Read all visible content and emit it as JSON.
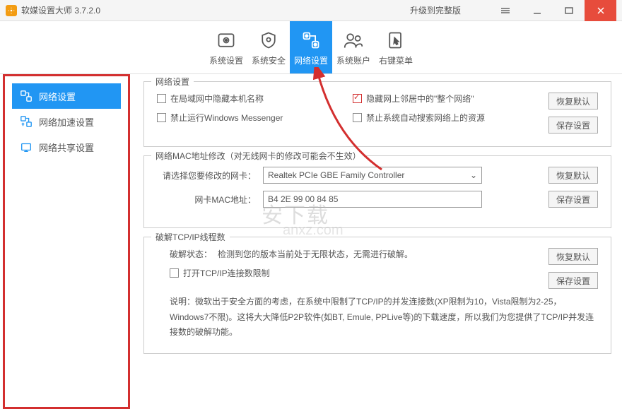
{
  "titlebar": {
    "title": "软媒设置大师 3.7.2.0",
    "upgrade": "升级到完整版"
  },
  "tabs": [
    {
      "label": "系统设置"
    },
    {
      "label": "系统安全"
    },
    {
      "label": "网络设置"
    },
    {
      "label": "系统账户"
    },
    {
      "label": "右键菜单"
    }
  ],
  "sidebar": [
    {
      "label": "网络设置"
    },
    {
      "label": "网络加速设置"
    },
    {
      "label": "网络共享设置"
    }
  ],
  "group1": {
    "title": "网络设置",
    "chk1": "在局域网中隐藏本机名称",
    "chk2": "隐藏网上邻居中的\"整个网络\"",
    "chk3": "禁止运行Windows Messenger",
    "chk4": "禁止系统自动搜索网络上的资源",
    "btn_reset": "恢复默认",
    "btn_save": "保存设置"
  },
  "group2": {
    "title": "网络MAC地址修改（对无线网卡的修改可能会不生效）",
    "label_nic": "请选择您要修改的网卡：",
    "nic_value": "Realtek PCIe GBE Family Controller",
    "label_mac": "网卡MAC地址：",
    "mac_value": "B4 2E 99 00 84 85",
    "btn_reset": "恢复默认",
    "btn_save": "保存设置"
  },
  "group3": {
    "title": "破解TCP/IP线程数",
    "status_label": "破解状态：",
    "status_value": "检测到您的版本当前处于无限状态，无需进行破解。",
    "chk": "打开TCP/IP连接数限制",
    "desc": "说明：微软出于安全方面的考虑，在系统中限制了TCP/IP的并发连接数(XP限制为10，Vista限制为2-25，Windows7不限)。这将大大降低P2P软件(如BT, Emule, PPLive等)的下载速度，所以我们为您提供了TCP/IP并发连接数的破解功能。",
    "btn_reset": "恢复默认",
    "btn_save": "保存设置"
  }
}
